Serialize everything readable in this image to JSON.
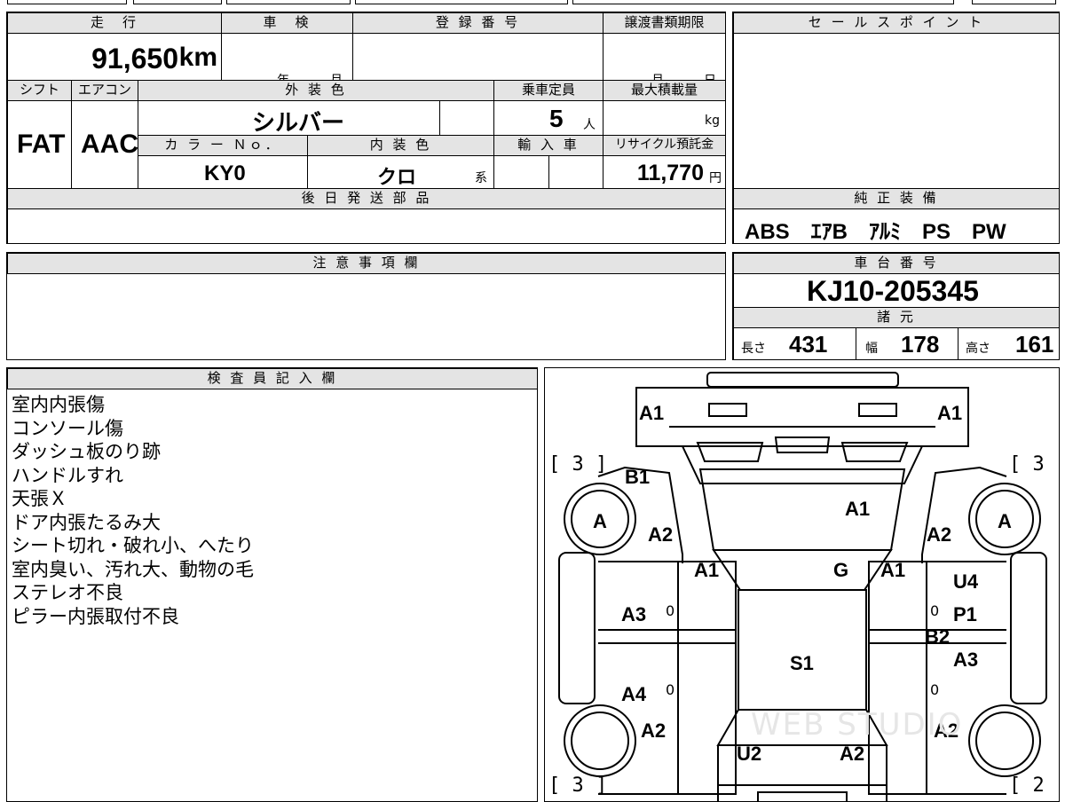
{
  "mileage": {
    "label": "走　行",
    "value": "91,650",
    "unit": "km"
  },
  "inspection": {
    "label": "車　検",
    "year": "年",
    "month": "月"
  },
  "registration": {
    "label": "登 録 番 号",
    "value": ""
  },
  "transfer_deadline": {
    "label": "譲渡書類期限",
    "month": "月",
    "day": "日"
  },
  "shift": {
    "label": "シフト",
    "value": "FAT"
  },
  "aircon": {
    "label": "エアコン",
    "value": "AAC"
  },
  "exterior_color": {
    "label": "外 装 色",
    "value": "シルバー"
  },
  "capacity": {
    "label": "乗車定員",
    "value": "5",
    "unit": "人"
  },
  "max_load": {
    "label": "最大積載量",
    "unit": "kg"
  },
  "color_no": {
    "label": "カ ラ ー Ｎｏ．",
    "value": "KY0"
  },
  "interior_color": {
    "label": "内 装 色",
    "value": "クロ",
    "suffix": "系"
  },
  "import": {
    "label": "輸 入 車"
  },
  "recycle": {
    "label": "リサイクル預託金",
    "value": "11,770",
    "unit": "円"
  },
  "later_parts": {
    "label": "後 日 発 送 部 品"
  },
  "sales_point": {
    "label": "セ ー ル ス ポ イ ン ト"
  },
  "genuine_equipment": {
    "label": "純 正 装 備",
    "value": "ABS　ｴｱB　ｱﾙﾐ　PS　PW"
  },
  "notes_field": {
    "label": "注 意 事 項 欄"
  },
  "chassis_number": {
    "label": "車 台 番 号",
    "value": "KJ10-205345"
  },
  "specs": {
    "label": "諸 元",
    "length_label": "長さ",
    "length": "431",
    "width_label": "幅",
    "width": "178",
    "height_label": "高さ",
    "height": "161"
  },
  "inspector": {
    "label": "検 査 員 記 入 欄",
    "notes": [
      "室内内張傷",
      "コンソール傷",
      "ダッシュ板のり跡",
      "ハンドルすれ",
      "天張Ｘ",
      "ドア内張たるみ大",
      "シート切れ・破れ小、へたり",
      "室内臭い、汚れ大、動物の毛",
      "ステレオ不良",
      "ピラー内張取付不良"
    ]
  },
  "diagram": {
    "labels": [
      "A1",
      "A1",
      "B1",
      "A1",
      "A2",
      "A2",
      "A1",
      "G",
      "A1",
      "U4",
      "A3",
      "P1",
      "B2",
      "S1",
      "A3",
      "A4",
      "A2",
      "A2",
      "U2",
      "A2",
      "A",
      "A"
    ],
    "brackets": [
      "[ 3 ]",
      "[ 3 ]",
      "[ 3 ]",
      "[ 2 ]"
    ],
    "zeros": [
      "0",
      "0",
      "0",
      "0"
    ],
    "watermark": "WEB STUDIO"
  }
}
